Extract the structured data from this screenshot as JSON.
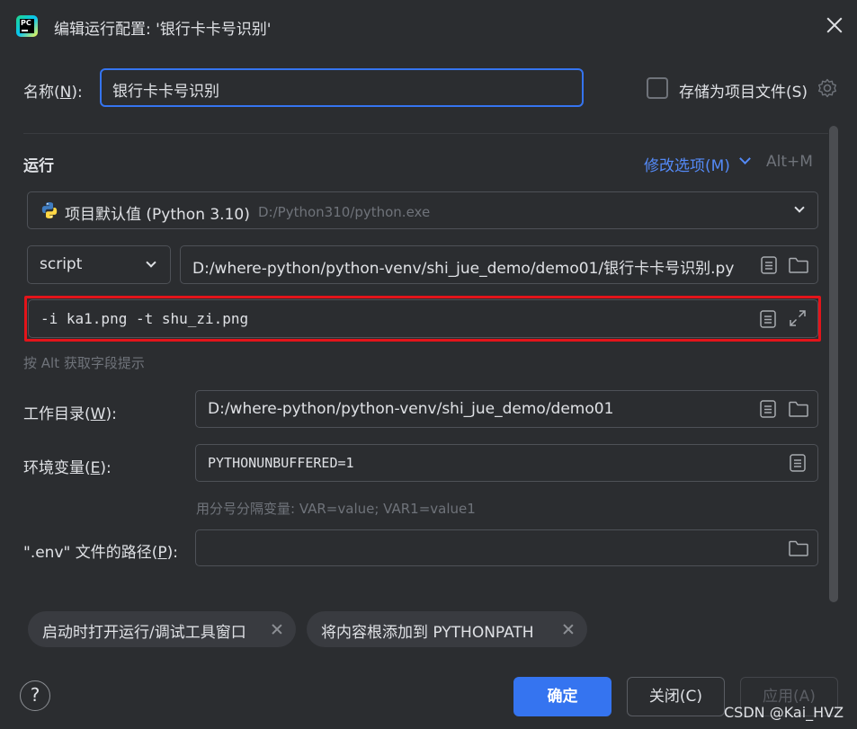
{
  "window": {
    "title": "编辑运行配置: '银行卡卡号识别'",
    "app_icon": "pycharm-logo"
  },
  "name": {
    "label_prefix": "名称(",
    "label_key": "N",
    "label_suffix": "):",
    "value": "银行卡卡号识别"
  },
  "store_as_project_file": {
    "label": "存储为项目文件(S)",
    "checked": false
  },
  "run_section": {
    "title": "运行",
    "modify_options": "修改选项(M)",
    "shortcut": "Alt+M"
  },
  "interpreter": {
    "name": "项目默认值 (Python 3.10)",
    "path": "D:/Python310/python.exe"
  },
  "script": {
    "type": "script",
    "path": "D:/where-python/python-venv/shi_jue_demo/demo01/银行卡卡号识别.py"
  },
  "parameters": {
    "value": "-i ka1.png -t shu_zi.png",
    "hint": "按 Alt 获取字段提示"
  },
  "working_dir": {
    "label_prefix": "工作目录(",
    "label_key": "W",
    "label_suffix": "):",
    "value": "D:/where-python/python-venv/shi_jue_demo/demo01"
  },
  "env_vars": {
    "label_prefix": "环境变量(",
    "label_key": "E",
    "label_suffix": "):",
    "value": "PYTHONUNBUFFERED=1",
    "hint": "用分号分隔变量: VAR=value; VAR1=value1"
  },
  "env_file": {
    "label_prefix": "\".env\" 文件的路径(",
    "label_key": "P",
    "label_suffix": "):",
    "value": ""
  },
  "chips": [
    {
      "label": "启动时打开运行/调试工具窗口"
    },
    {
      "label": "将内容根添加到 PYTHONPATH"
    }
  ],
  "buttons": {
    "help": "?",
    "ok": "确定",
    "close": "关闭(C)",
    "apply": "应用(A)"
  },
  "watermark": "CSDN @Kai_HVZ",
  "colors": {
    "background": "#2b2d30",
    "accent": "#3574f0",
    "link": "#548af7",
    "highlight_box": "#e3141a"
  }
}
